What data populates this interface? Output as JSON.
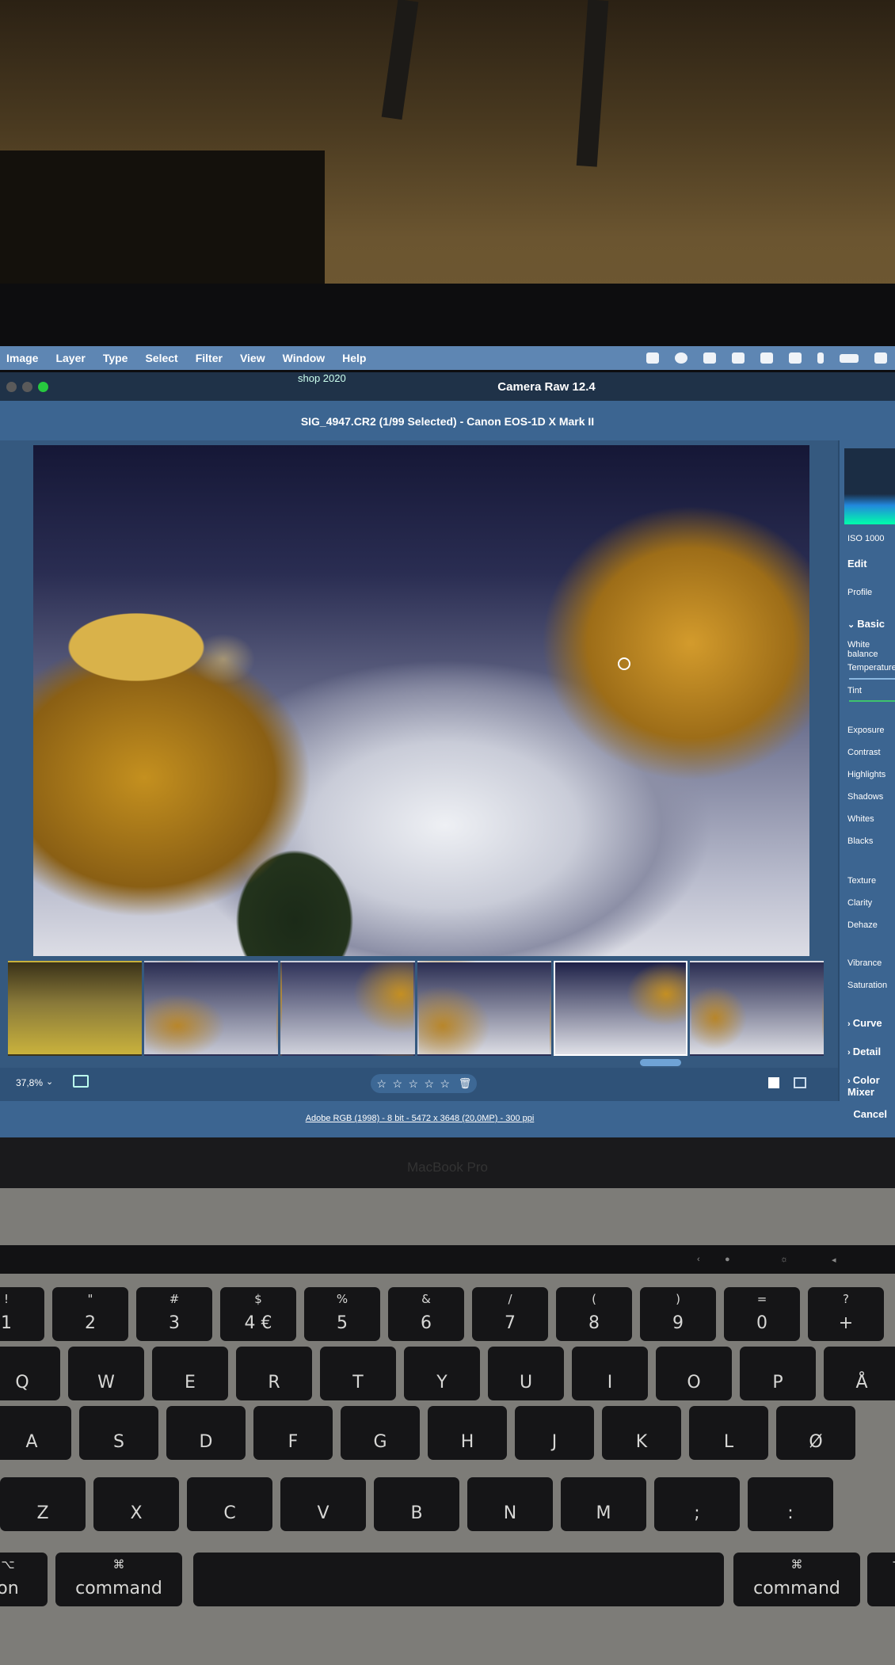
{
  "menubar": {
    "items": [
      "Image",
      "Layer",
      "Type",
      "Select",
      "Filter",
      "View",
      "Window",
      "Help"
    ],
    "status_icons": [
      "dropbox-icon",
      "creative-cloud-icon",
      "user-icon",
      "layout-icon",
      "screen-mirror-icon",
      "mute-icon",
      "bluetooth-icon",
      "battery-icon",
      "wifi-icon"
    ]
  },
  "window": {
    "title": "Camera Raw 12.4",
    "behind_tab": "shop 2020",
    "file_info": "SIG_4947.CR2 (1/99 Selected)  -  Canon EOS-1D X Mark II"
  },
  "bottom_toolbar": {
    "zoom": "37,8%",
    "rating_stars": [
      "☆",
      "☆",
      "☆",
      "☆",
      "☆"
    ]
  },
  "footer": {
    "info": "Adobe RGB (1998) - 8 bit - 5472 x 3648 (20,0MP) - 300 ppi",
    "cancel": "Cancel"
  },
  "right_panel": {
    "iso": "ISO 1000",
    "edit": "Edit",
    "profile": "Profile",
    "basic": "Basic",
    "white_balance": "White balance",
    "temperature": "Temperature",
    "tint": "Tint",
    "sliders": [
      "Exposure",
      "Contrast",
      "Highlights",
      "Shadows",
      "Whites",
      "Blacks"
    ],
    "presence": [
      "Texture",
      "Clarity",
      "Dehaze"
    ],
    "color": [
      "Vibrance",
      "Saturation"
    ],
    "sections": [
      "Curve",
      "Detail",
      "Color Mixer"
    ]
  },
  "device": {
    "label": "MacBook Pro"
  },
  "keyboard": {
    "numbers": [
      {
        "top": "!",
        "main": "1"
      },
      {
        "top": "\"",
        "main": "2"
      },
      {
        "top": "#",
        "main": "3"
      },
      {
        "top": "$",
        "main": "4 €"
      },
      {
        "top": "%",
        "main": "5"
      },
      {
        "top": "&",
        "main": "6"
      },
      {
        "top": "/",
        "main": "7"
      },
      {
        "top": "(",
        "main": "8"
      },
      {
        "top": ")",
        "main": "9"
      },
      {
        "top": "=",
        "main": "0"
      },
      {
        "top": "?",
        "main": "+"
      }
    ],
    "row_q": [
      "Q",
      "W",
      "E",
      "R",
      "T",
      "Y",
      "U",
      "I",
      "O",
      "P",
      "Å"
    ],
    "row_a": [
      "A",
      "S",
      "D",
      "F",
      "G",
      "H",
      "J",
      "K",
      "L",
      "Ø"
    ],
    "row_z": [
      "Z",
      "X",
      "C",
      "V",
      "B",
      "N",
      "M",
      ";",
      ":"
    ],
    "bottom_left_option": "⌥",
    "option_label": "on",
    "command_symbol": "⌘",
    "command_label": "command"
  }
}
